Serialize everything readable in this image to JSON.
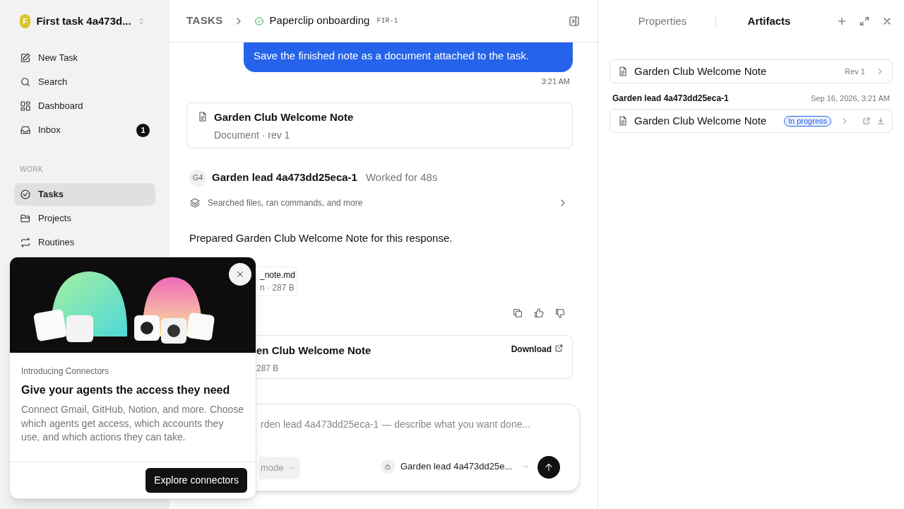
{
  "sidebar": {
    "workspace": {
      "initial": "F",
      "name": "First task 4a473d..."
    },
    "nav_items": [
      {
        "label": "New Task",
        "selected": false
      },
      {
        "label": "Search",
        "selected": false
      },
      {
        "label": "Dashboard",
        "selected": false
      },
      {
        "label": "Inbox",
        "selected": false,
        "badge": "1"
      }
    ],
    "section_label": "WORK",
    "work_items": [
      {
        "label": "Tasks",
        "selected": true
      },
      {
        "label": "Projects",
        "selected": false
      },
      {
        "label": "Routines",
        "selected": false
      }
    ]
  },
  "header": {
    "breadcrumb": "TASKS",
    "title": "Paperclip onboarding",
    "task_id": "FIR-1"
  },
  "conversation": {
    "user_message": "Save the finished note as a document attached to the task.",
    "message_time": "3:21 AM",
    "document_card": {
      "title": "Garden Club Welcome Note",
      "meta": "Document · rev 1"
    },
    "agent": {
      "avatar": "G4",
      "name": "Garden lead 4a473dd25eca-1",
      "duration": "Worked for 48s",
      "activity": "Searched files, ran commands, and more",
      "response": "Prepared Garden Club Welcome Note for this response."
    },
    "file_card": {
      "name": "_note.md",
      "meta": "n · 287 B"
    },
    "download_card": {
      "title": "en Club Welcome Note",
      "meta": "287 B",
      "action": "Download"
    }
  },
  "composer": {
    "placeholder": "rden lead 4a473dd25eca-1 — describe what you want done...",
    "mode": "mode",
    "agent": "Garden lead 4a473dd25e..."
  },
  "popover": {
    "eyebrow": "Introducing Connectors",
    "title": "Give your agents the access they need",
    "body": "Connect Gmail, GitHub, Notion, and more. Choose which agents get access, which accounts they use, and which actions they can take.",
    "button": "Explore connectors"
  },
  "right_panel": {
    "tabs": [
      {
        "label": "Properties",
        "selected": false
      },
      {
        "label": "Artifacts",
        "selected": true
      }
    ],
    "artifact": {
      "title": "Garden Club Welcome Note",
      "revision": "Rev 1"
    },
    "group": {
      "author": "Garden lead 4a473dd25eca-1",
      "date": "Sep 16, 2026, 3:21 AM",
      "items": [
        {
          "title": "Garden Club Welcome Note",
          "status": "In progress"
        }
      ]
    }
  }
}
